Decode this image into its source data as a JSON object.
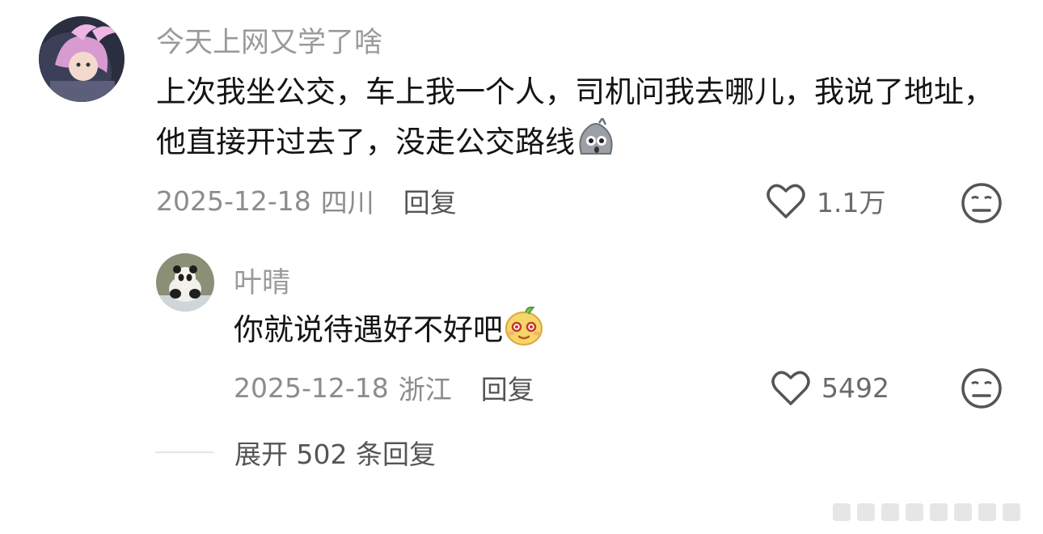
{
  "comment": {
    "username": "今天上网又学了啥",
    "text": "上次我坐公交，车上我一个人，司机问我去哪儿，我说了地址，他直接开过去了，没走公交路线",
    "emoji_icon": "shocked-face-emoji",
    "date": "2025-12-18",
    "location": "四川",
    "reply_label": "回复",
    "likes": "1.1万"
  },
  "reply": {
    "username": "叶晴",
    "text": "你就说待遇好不好吧",
    "emoji_icon": "smirk-face-emoji",
    "date": "2025-12-18",
    "location": "浙江",
    "reply_label": "回复",
    "likes": "5492"
  },
  "expand": {
    "label": "展开 502 条回复"
  },
  "icons": {
    "like": "heart-outline-icon",
    "dislike": "neutral-face-icon"
  },
  "colors": {
    "username": "#9a9a9a",
    "text": "#141414",
    "meta": "#8c8c8c",
    "reply": "#555555"
  }
}
